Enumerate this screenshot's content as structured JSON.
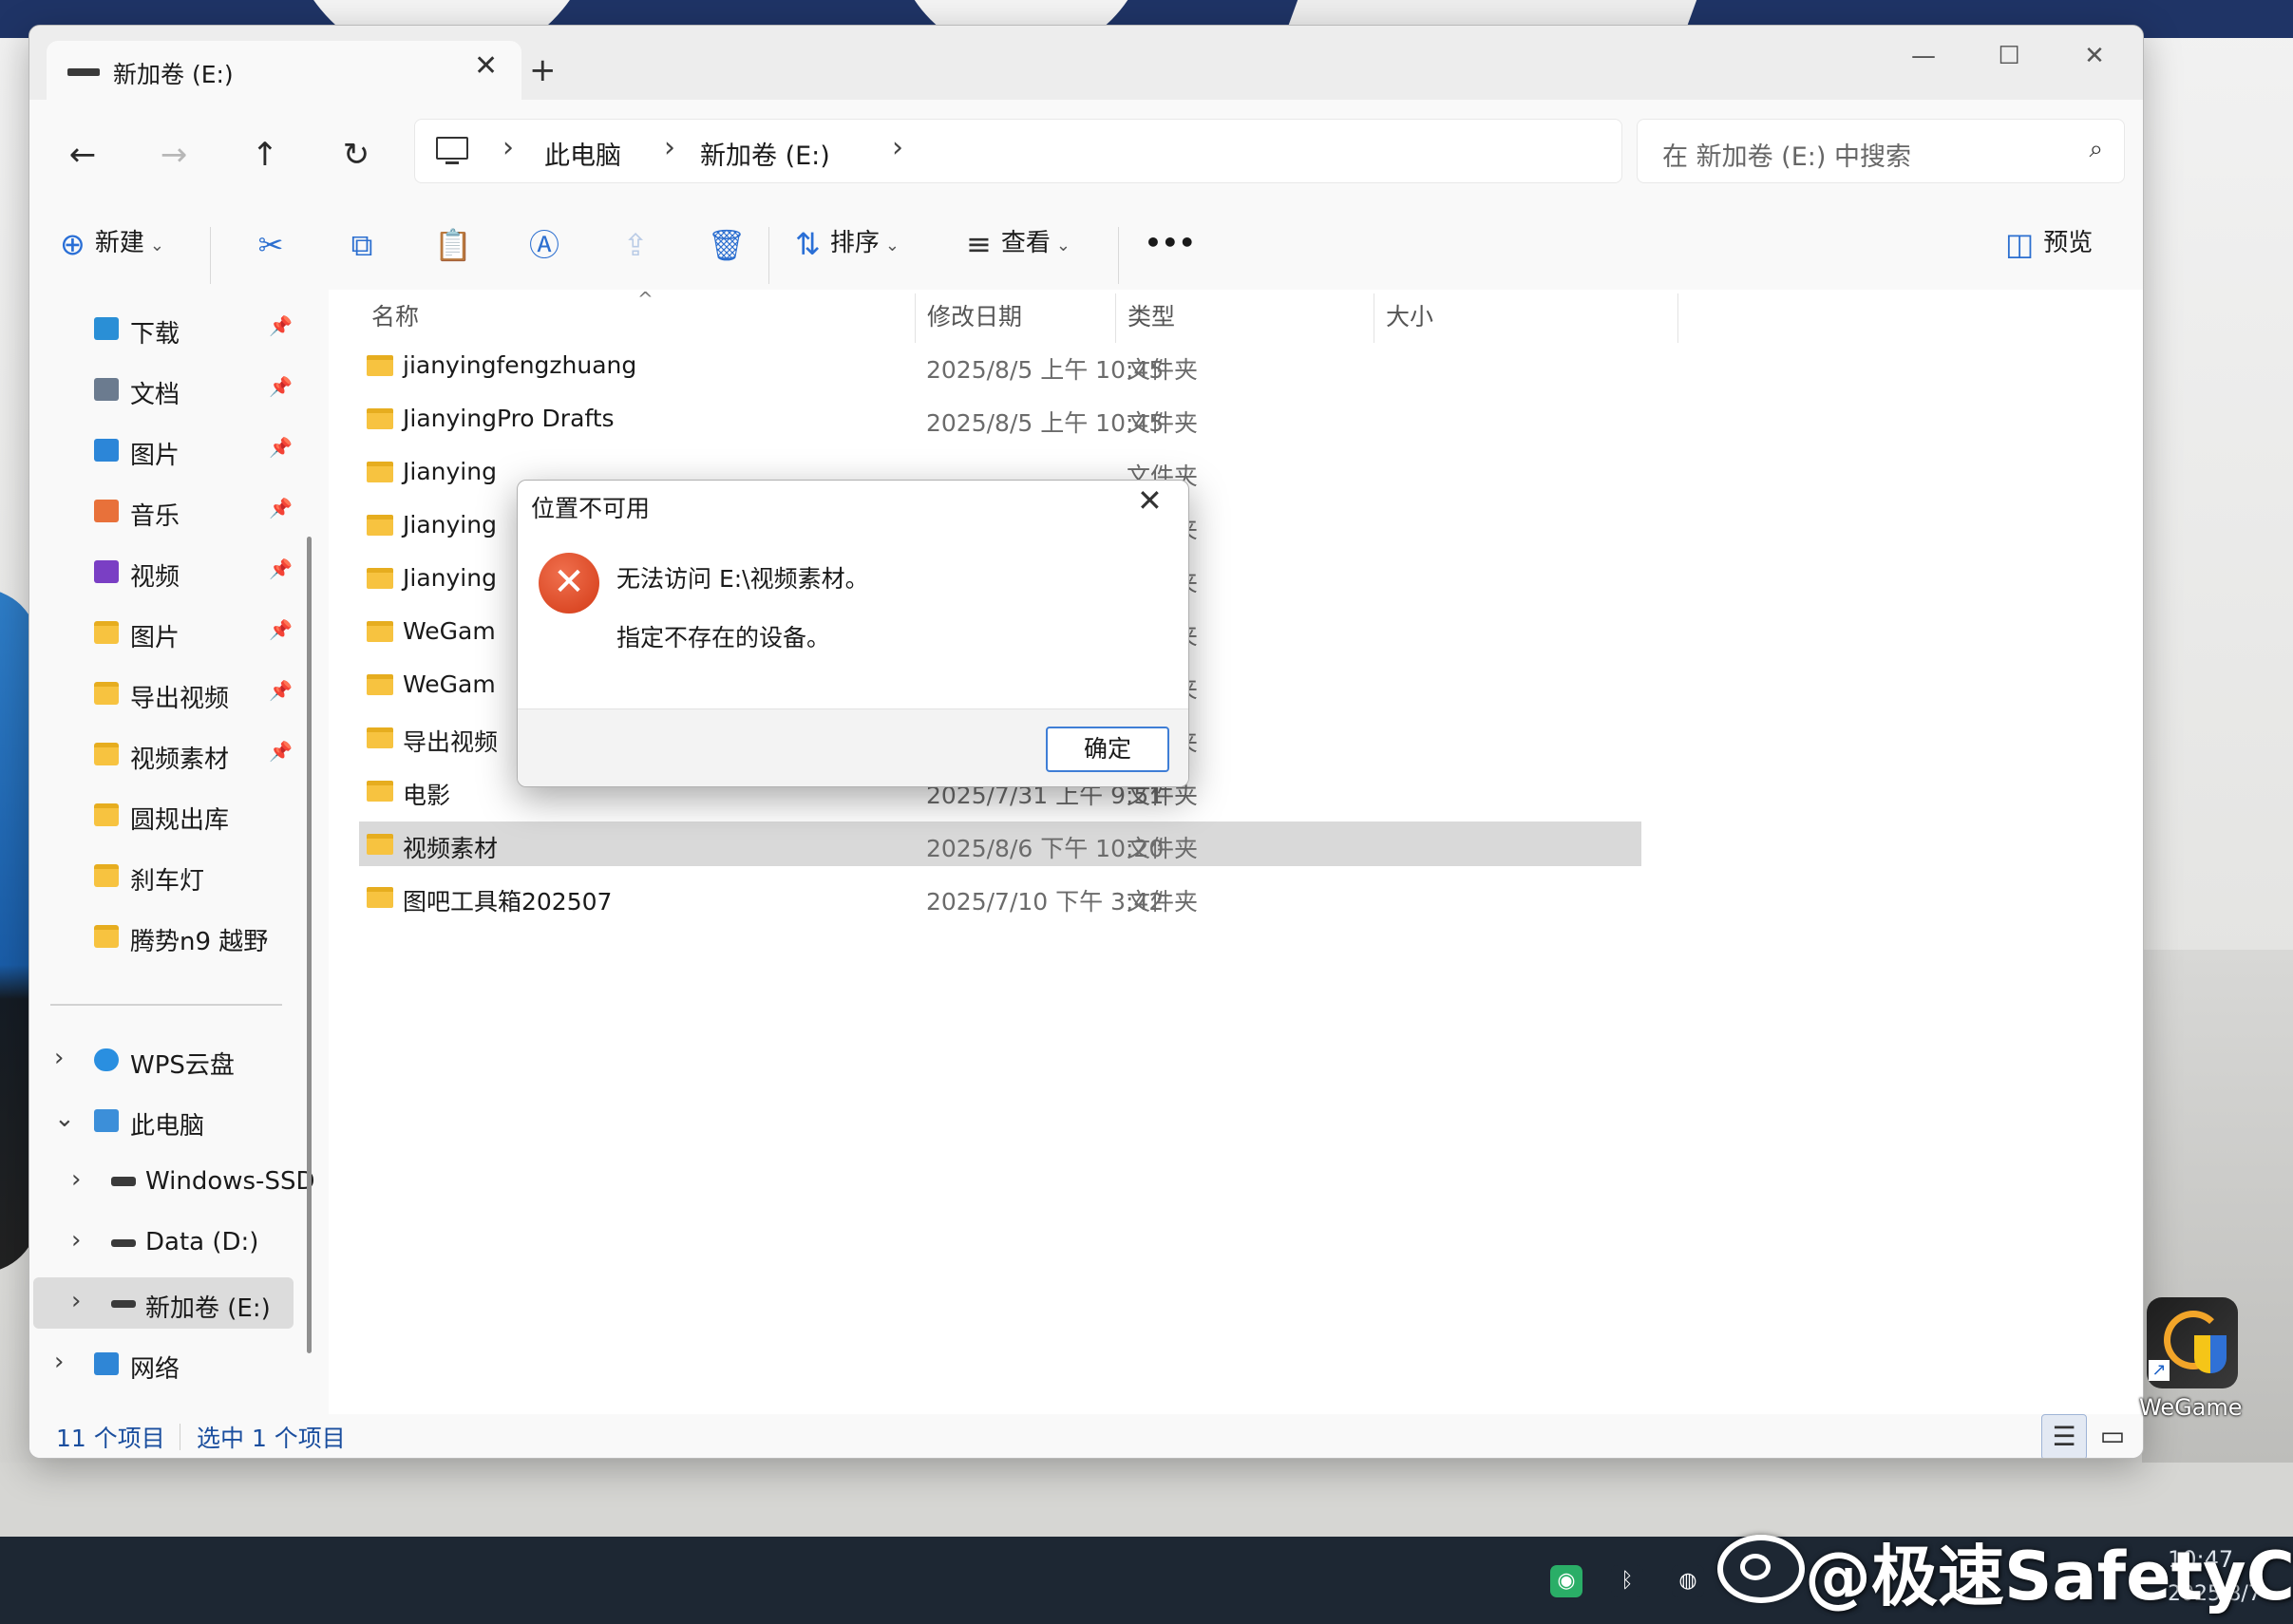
{
  "window": {
    "tab_title": "新加卷 (E:)",
    "tab_close": "✕",
    "new_tab": "+",
    "controls": {
      "minimize": "—",
      "maximize": "☐",
      "close": "✕"
    }
  },
  "nav": {
    "back": "←",
    "forward": "→",
    "up": "↑",
    "refresh": "↻",
    "breadcrumb": [
      "此电脑",
      "新加卷 (E:)"
    ],
    "sep": "›",
    "search_placeholder": "在 新加卷 (E:) 中搜索",
    "search_icon": "⌕"
  },
  "toolbar": {
    "new_label": "新建",
    "new_icon": "⊕",
    "sort_label": "排序",
    "sort_icon": "⇅",
    "view_label": "查看",
    "view_icon": "≡",
    "more": "•••",
    "preview_label": "预览",
    "preview_icon": "◫",
    "chev": "⌄",
    "icons": {
      "cut": "✂",
      "copy": "⧉",
      "paste": "📋",
      "rename": "Ⓐ",
      "share": "⇪",
      "delete": "🗑"
    }
  },
  "sidebar": {
    "quick_access": [
      {
        "label": "下载",
        "icon": "download-icon",
        "color": "#2a8fd6"
      },
      {
        "label": "文档",
        "icon": "document-icon",
        "color": "#6b7b8f"
      },
      {
        "label": "图片",
        "icon": "pictures-icon",
        "color": "#2c86d8"
      },
      {
        "label": "音乐",
        "icon": "music-icon",
        "color": "#e8713a"
      },
      {
        "label": "视频",
        "icon": "videos-icon",
        "color": "#7a3fc4"
      },
      {
        "label": "图片",
        "icon": "folder-icon",
        "color": "#f7c340"
      },
      {
        "label": "导出视频",
        "icon": "folder-icon",
        "color": "#f7c340"
      },
      {
        "label": "视频素材",
        "icon": "folder-icon",
        "color": "#f7c340"
      },
      {
        "label": "圆规出库",
        "icon": "folder-icon",
        "color": "#f7c340"
      },
      {
        "label": "刹车灯",
        "icon": "folder-icon",
        "color": "#f7c340"
      },
      {
        "label": "腾势n9 越野",
        "icon": "folder-icon",
        "color": "#f7c340"
      }
    ],
    "pin": "📌",
    "tree": {
      "wps": "WPS云盘",
      "this_pc": "此电脑",
      "drive_c": "Windows-SSD",
      "drive_d": "Data (D:)",
      "drive_e": "新加卷 (E:)",
      "network": "网络",
      "chev_right": "›",
      "chev_down": "⌄"
    }
  },
  "columns": {
    "name": "名称",
    "date": "修改日期",
    "type": "类型",
    "size": "大小",
    "sort_indicator": "^"
  },
  "files": [
    {
      "name": "jianyingfengzhuang",
      "date": "2025/8/5 上午 10:45",
      "type": "文件夹"
    },
    {
      "name": "JianyingPro Drafts",
      "date": "2025/8/5 上午 10:45",
      "type": "文件夹"
    },
    {
      "name": "Jianying",
      "date": "",
      "type": "文件夹"
    },
    {
      "name": "Jianying",
      "date": "",
      "type": "文件夹"
    },
    {
      "name": "Jianying",
      "date": "",
      "type": "文件夹"
    },
    {
      "name": "WeGam",
      "date": "",
      "type": "文件夹"
    },
    {
      "name": "WeGam",
      "date": "",
      "type": "文件夹"
    },
    {
      "name": "导出视频",
      "date": "",
      "type": "文件夹"
    },
    {
      "name": "电影",
      "date": "2025/7/31 上午 9:51",
      "type": "文件夹"
    },
    {
      "name": "视频素材",
      "date": "2025/8/6 下午 10:20",
      "type": "文件夹"
    },
    {
      "name": "图吧工具箱202507",
      "date": "2025/7/10 下午 3:42",
      "type": "文件夹"
    }
  ],
  "status": {
    "count": "11 个项目",
    "selected": "选中 1 个项目",
    "details_icon": "☰",
    "tiles_icon": "▭"
  },
  "dialog": {
    "title": "位置不可用",
    "close": "✕",
    "error_icon": "✕",
    "message": "无法访问 E:\\视频素材。",
    "detail": "指定不存在的设备。",
    "ok": "确定"
  },
  "desktop": {
    "wegame_label": "WeGame",
    "shortcut_arrow": "↗",
    "watermark": "@极速SafetyCar"
  },
  "taskbar": {
    "time": "10:47",
    "date": "2025/8/7",
    "tray": [
      {
        "name": "wechat-icon",
        "glyph": "◉",
        "color": "#2aae67"
      },
      {
        "name": "bluetooth-icon",
        "glyph": "ᛒ",
        "color": "#1d2733"
      },
      {
        "name": "qq-icon",
        "glyph": "◍",
        "color": "#1d2733"
      }
    ]
  }
}
